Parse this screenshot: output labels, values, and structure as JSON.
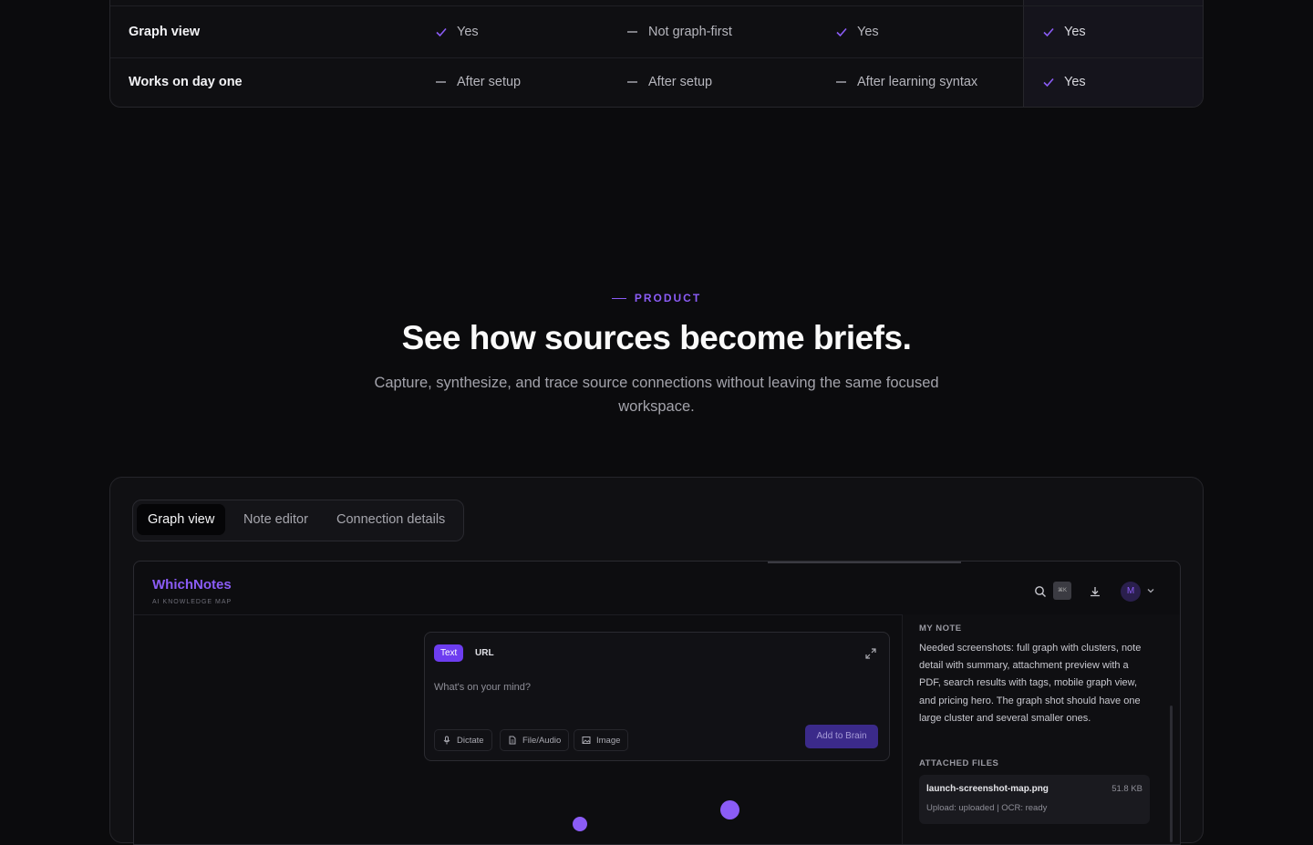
{
  "comparison": {
    "rows": [
      {
        "feature": "Graph view",
        "cells": [
          {
            "mark": "check",
            "text": "Yes"
          },
          {
            "mark": "dash",
            "text": "Not graph-first"
          },
          {
            "mark": "check",
            "text": "Yes"
          },
          {
            "mark": "check",
            "text": "Yes"
          }
        ]
      },
      {
        "feature": "Works on day one",
        "cells": [
          {
            "mark": "dash",
            "text": "After setup"
          },
          {
            "mark": "dash",
            "text": "After setup"
          },
          {
            "mark": "dash",
            "text": "After learning syntax"
          },
          {
            "mark": "check",
            "text": "Yes"
          }
        ]
      }
    ]
  },
  "product": {
    "eyebrow": "PRODUCT",
    "headline": "See how sources become briefs.",
    "subhead": "Capture, synthesize, and trace source connections without leaving the same focused workspace."
  },
  "showcase": {
    "tabs": [
      {
        "label": "Graph view",
        "active": true
      },
      {
        "label": "Note editor",
        "active": false
      },
      {
        "label": "Connection details",
        "active": false
      }
    ]
  },
  "app": {
    "brand": "WhichNotes",
    "brand_sub": "AI KNOWLEDGE MAP",
    "kbd": "⌘K",
    "avatar": "M",
    "composer": {
      "mode_active": "Text",
      "mode_other": "URL",
      "placeholder": "What's on your mind?",
      "tools": [
        "Dictate",
        "File/Audio",
        "Image"
      ],
      "submit": "Add to Brain"
    },
    "note_panel": {
      "title": "MY NOTE",
      "body": "Needed screenshots: full graph with clusters, note detail with summary, attachment preview with a PDF, search results with tags, mobile graph view, and pricing hero. The graph shot should have one large cluster and several smaller ones.",
      "attached_label": "ATTACHED FILES",
      "file": {
        "name": "launch-screenshot-map.png",
        "size": "51.8 KB",
        "meta": "Upload: uploaded | OCR: ready"
      }
    }
  },
  "colors": {
    "accent": "#8b5cf6",
    "background": "#0b0b0d",
    "button": "#6d3df0"
  }
}
